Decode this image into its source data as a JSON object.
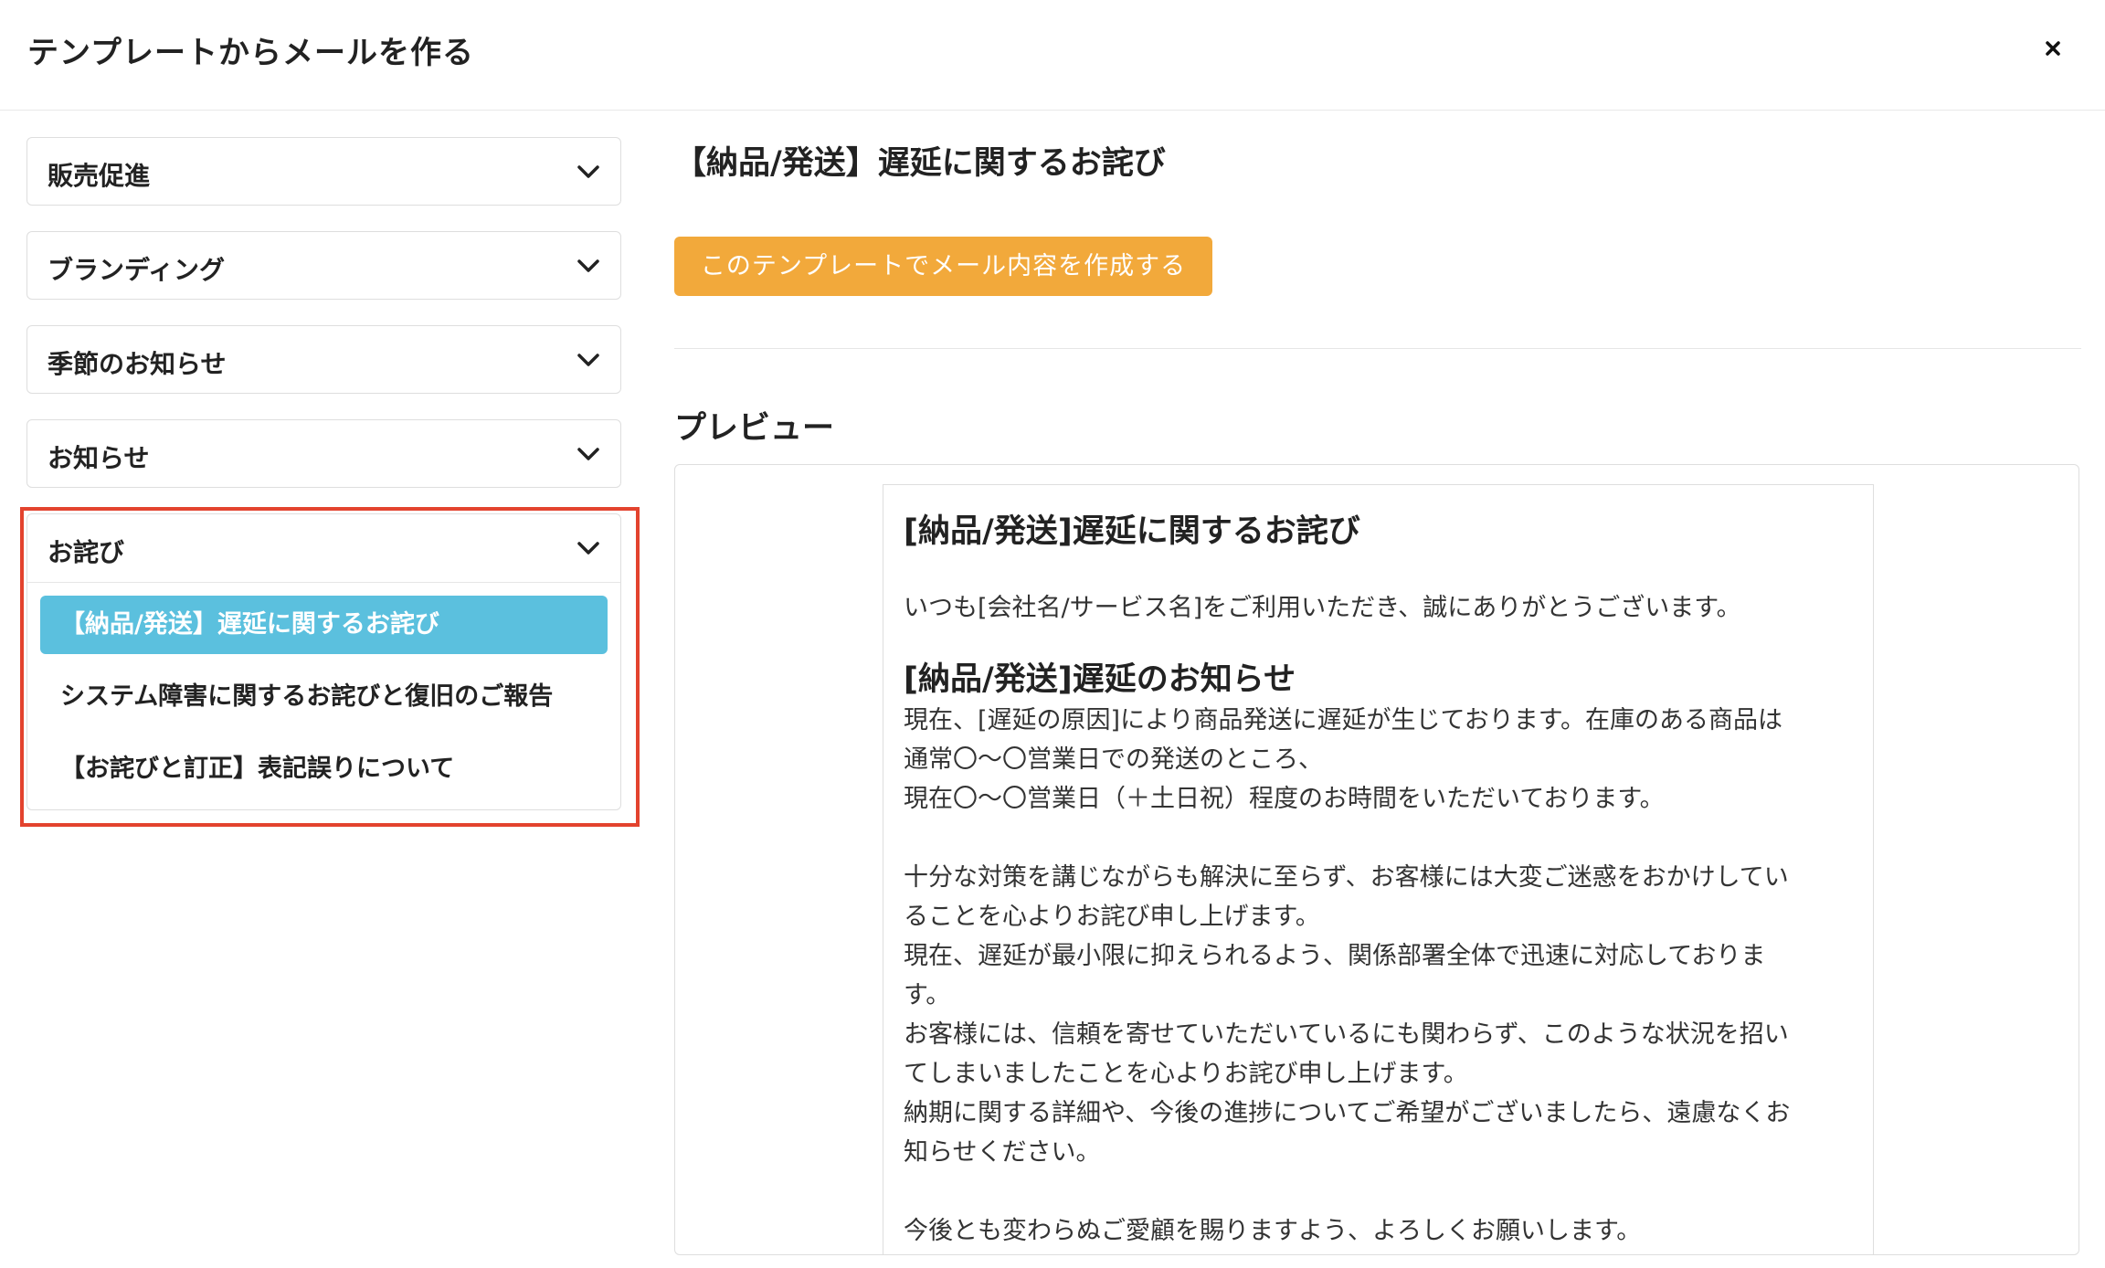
{
  "header": {
    "title": "テンプレートからメールを作る",
    "close_icon": "close-icon"
  },
  "sidebar": {
    "categories": [
      {
        "label": "販売促進"
      },
      {
        "label": "ブランディング"
      },
      {
        "label": "季節のお知らせ"
      },
      {
        "label": "お知らせ"
      }
    ],
    "open_category": {
      "label": "お詫び",
      "items": [
        {
          "label": "【納品/発送】遅延に関するお詫び",
          "active": true
        },
        {
          "label": "システム障害に関するお詫びと復旧のご報告",
          "active": false
        },
        {
          "label": "【お詫びと訂正】表記誤りについて",
          "active": false
        }
      ]
    }
  },
  "main": {
    "title": "【納品/発送】遅延に関するお詫び",
    "create_button_label": "このテンプレートでメール内容を作成する",
    "preview_heading": "プレビュー"
  },
  "preview": {
    "heading": "[納品/発送]遅延に関するお詫び",
    "intro": "いつも[会社名/サービス名]をご利用いただき、誠にありがとうございます。",
    "subheading": "[納品/発送]遅延のお知らせ",
    "paragraph1": [
      "現在、[遅延の原因]により商品発送に遅延が生じております。在庫のある商品は",
      "通常〇〜〇営業日での発送のところ、",
      "現在〇〜〇営業日（＋土日祝）程度のお時間をいただいております。"
    ],
    "paragraph2": [
      "十分な対策を講じながらも解決に至らず、お客様には大変ご迷惑をおかけしてい",
      "ることを心よりお詫び申し上げます。",
      "現在、遅延が最小限に抑えられるよう、関係部署全体で迅速に対応しておりま",
      "す。",
      "お客様には、信頼を寄せていただいているにも関わらず、このような状況を招い",
      "てしまいましたことを心よりお詫び申し上げます。",
      "納期に関する詳細や、今後の進捗についてご希望がございましたら、遠慮なくお",
      "知らせください。"
    ],
    "closing": "今後とも変わらぬご愛顧を賜りますよう、よろしくお願いします。"
  },
  "colors": {
    "accent_button": "#f2a93b",
    "active_item": "#5bc0de",
    "highlight_border": "#e3432e"
  }
}
